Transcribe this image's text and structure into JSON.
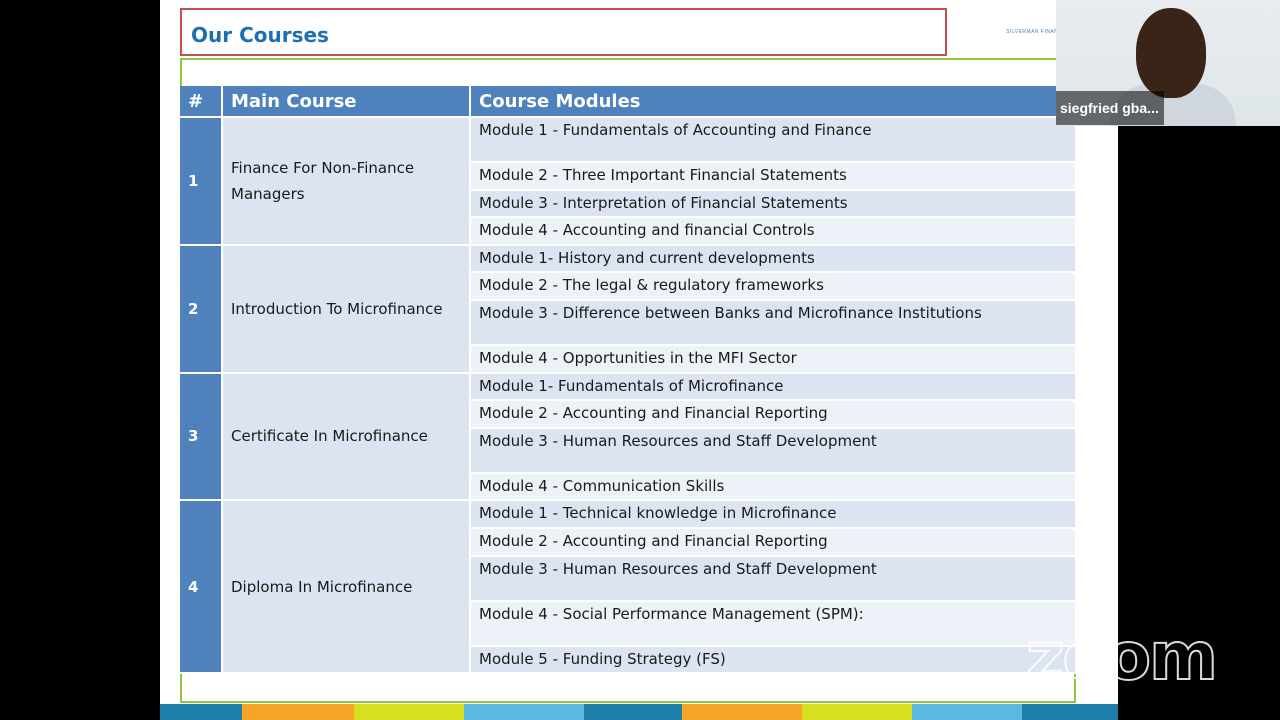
{
  "slide": {
    "title": "Our Courses",
    "logo_text": "SILVERMAN FINANCIAL",
    "table": {
      "headers": {
        "num": "#",
        "course": "Main Course",
        "modules": "Course Modules"
      },
      "rows": [
        {
          "num": "1",
          "course": "Finance For Non-Finance Managers",
          "modules": [
            "Module 1 - Fundamentals of Accounting and Finance",
            "Module 2 - Three Important Financial Statements",
            "Module 3 - Interpretation of Financial Statements",
            "Module 4 - Accounting and financial Controls"
          ]
        },
        {
          "num": "2",
          "course": "Introduction To Microfinance",
          "modules": [
            "Module 1- History and current developments",
            "Module 2 - The legal & regulatory frameworks",
            "Module 3 - Difference between Banks and Microfinance Institutions",
            "Module 4 - Opportunities in the MFI Sector"
          ]
        },
        {
          "num": "3",
          "course": "Certificate In Microfinance",
          "modules": [
            "Module 1- Fundamentals of Microfinance",
            "Module 2 - Accounting and Financial Reporting",
            "Module 3 - Human Resources and Staff Development",
            "Module 4 - Communication Skills"
          ]
        },
        {
          "num": "4",
          "course": "Diploma In Microfinance",
          "modules": [
            "Module 1 - Technical knowledge in Microfinance",
            "Module 2 - Accounting and Financial Reporting",
            "Module 3 - Human Resources and Staff Development",
            "Module 4 - Social Performance Management (SPM):",
            "Module 5 - Funding Strategy (FS)"
          ]
        }
      ]
    }
  },
  "webcam": {
    "participant_name": "siegfried gba..."
  },
  "watermark": "zoom",
  "colors": {
    "header_blue": "#4f81bd",
    "title_blue": "#1f6fb0",
    "title_border": "#c0504d",
    "accent_green": "#8dc63f"
  }
}
